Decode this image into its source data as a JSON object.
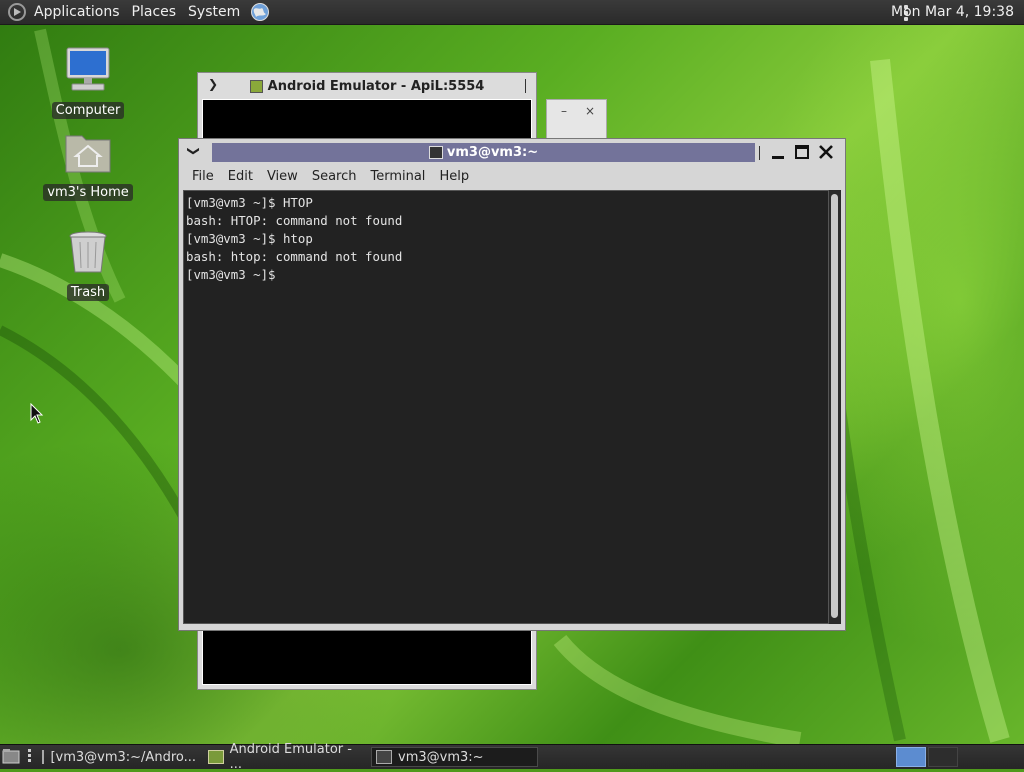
{
  "top_panel": {
    "menus": [
      "Applications",
      "Places",
      "System"
    ],
    "clock": "Mon Mar  4, 19:38"
  },
  "desktop_icons": [
    {
      "label": "Computer",
      "icon": "computer-icon"
    },
    {
      "label": "vm3's Home",
      "icon": "home-folder-icon"
    },
    {
      "label": "Trash",
      "icon": "trash-icon"
    }
  ],
  "emulator_window": {
    "title": "Android Emulator - ApiL:5554"
  },
  "emulator_controls": {
    "minimize": "–",
    "close": "×"
  },
  "terminal_window": {
    "title": "vm3@vm3:~",
    "menus": [
      "File",
      "Edit",
      "View",
      "Search",
      "Terminal",
      "Help"
    ],
    "lines": [
      "[vm3@vm3 ~]$ HTOP",
      "bash: HTOP: command not found",
      "[vm3@vm3 ~]$ htop",
      "bash: htop: command not found",
      "[vm3@vm3 ~]$ "
    ]
  },
  "taskbar": {
    "tasks": [
      {
        "label": "[vm3@vm3:~/Andro...",
        "active": false
      },
      {
        "label": "Android Emulator - ...",
        "active": false
      },
      {
        "label": "vm3@vm3:~",
        "active": true
      }
    ]
  },
  "colors": {
    "titlebar_active": "#73739a",
    "terminal_bg": "#222222",
    "workspace_active": "#5c8cd0"
  }
}
